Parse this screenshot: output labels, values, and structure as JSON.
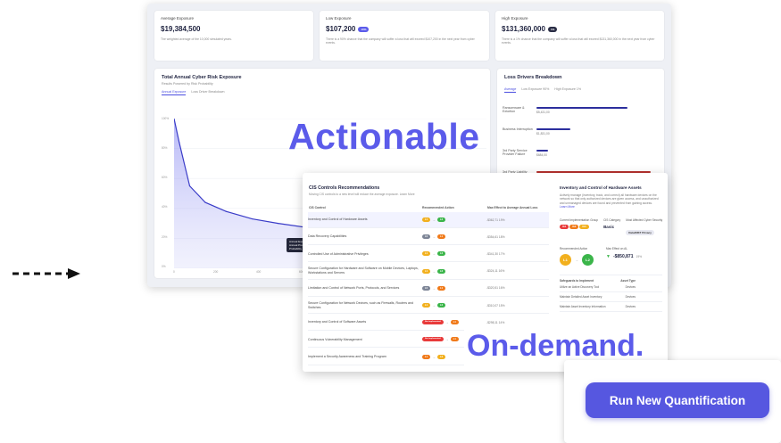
{
  "summary_cards": [
    {
      "title": "Average Exposure",
      "value": "$19,384,500",
      "tag": "",
      "desc": "The weighted average of the 10,000 simulated years."
    },
    {
      "title": "Low Exposure",
      "value": "$107,200",
      "tag": "10%",
      "desc": "There is a 90% chance that the company will suffer a loss that will exceed $107,200 in the next year from cyber events."
    },
    {
      "title": "High Exposure",
      "value": "$131,360,000",
      "tag": "1%",
      "desc": "There is a 1% chance that the company will suffer a loss that will exceed $131,360,000 in the next year from cyber events."
    }
  ],
  "exposure_chart": {
    "title": "Total Annual Cyber Risk Exposure",
    "subtitle": "Results Powered by Risk Probability",
    "tabs": [
      "Annual Exposure",
      "Loss Driver Breakdown"
    ],
    "y_ticks": [
      "100%",
      "80%",
      "60%",
      "40%",
      "20%",
      "0%"
    ],
    "x_ticks": [
      "0",
      "200",
      "400",
      "600"
    ],
    "tooltip": [
      "Annual Expo",
      "Annual Prob",
      "Probability"
    ]
  },
  "chart_data": {
    "type": "area",
    "title": "Total Annual Cyber Risk Exposure",
    "ylabel": "",
    "xlabel": "",
    "x": [
      0,
      10,
      30,
      60,
      100,
      150,
      200,
      300,
      400,
      500,
      580
    ],
    "y": [
      100,
      84,
      55,
      44,
      38,
      33,
      30,
      25,
      21,
      18,
      16
    ],
    "ylim": [
      0,
      100
    ],
    "xlim": [
      0,
      600
    ],
    "grid": true
  },
  "loss_drivers": {
    "title": "Loss Drivers Breakdown",
    "tabs": [
      "Average",
      "Low Exposure 90%",
      "High Exposure 1%"
    ],
    "items": [
      {
        "label": "Ransomware & Extortion",
        "value": "$5,431,00",
        "color": "#2c2f9e",
        "frac": 0.8
      },
      {
        "label": "Business Interruption",
        "value": "$1,831,00",
        "color": "#2c2f9e",
        "frac": 0.3
      },
      {
        "label": "3rd Party Service Provider Failure",
        "value": "$684,00",
        "color": "#2c2f9e",
        "frac": 0.1
      },
      {
        "label": "3rd Party Liability",
        "value": "$6,743,00",
        "color": "#b8322f",
        "frac": 1.0
      }
    ]
  },
  "overlay": {
    "actionable": "Actionable",
    "on_demand": "On-demand.",
    "run_button": "Run New Quantification"
  },
  "recommendations": {
    "title": "CIS Controls Recommendations",
    "subtitle": "Moving CIS controls to a new level will reduce the average exposure. Learn More",
    "columns": [
      "CIS Control",
      "Recommended Action",
      "Max Effect to Average Annual Loss"
    ],
    "rows": [
      {
        "name": "Inventory and Control of Hardware Assets",
        "from": "L1",
        "to": "L2",
        "from_color": "#f2b01e",
        "to_color": "#3bb54a",
        "effect": "-$362,71 19%"
      },
      {
        "name": "Data Recovery Capabilities",
        "from": "L0",
        "to": "L1",
        "from_color": "#7d8596",
        "to_color": "#f07a1a",
        "effect": "-$354,61 18%"
      },
      {
        "name": "Controlled Use of Administrative Privileges",
        "from": "L1",
        "to": "L2",
        "from_color": "#f2b01e",
        "to_color": "#3bb54a",
        "effect": "-$341,30 17%"
      },
      {
        "name": "Secure Configuration for Hardware and Software on Mobile Devices, Laptops, Workstations and Servers",
        "from": "L1",
        "to": "L2",
        "from_color": "#f2b01e",
        "to_color": "#3bb54a",
        "effect": "-$324,11 16%"
      },
      {
        "name": "Limitation and Control of Network Ports, Protocols, and Services",
        "from": "L0",
        "to": "L1",
        "from_color": "#7d8596",
        "to_color": "#f07a1a",
        "effect": "-$320,51 16%"
      },
      {
        "name": "Secure Configuration for Network Devices, such as Firewalls, Routers and Switches",
        "from": "L1",
        "to": "L2",
        "from_color": "#f2b01e",
        "to_color": "#3bb54a",
        "effect": "-$310,07 15%"
      },
      {
        "name": "Inventory and Control of Software Assets",
        "from": "Not implemented",
        "to": "L1",
        "from_color": "#e83a3a",
        "to_color": "#f07a1a",
        "effect": "-$298,11 14%"
      },
      {
        "name": "Continuous Vulnerability Management",
        "from": "Not implemented",
        "to": "L1",
        "from_color": "#e83a3a",
        "to_color": "#f07a1a",
        "effect": "-$281,40 13%"
      },
      {
        "name": "Implement a Security Awareness and Training Program",
        "from": "L1",
        "to": "L2",
        "from_color": "#f07a1a",
        "to_color": "#f2b01e",
        "effect": "-$270,63 12%"
      }
    ]
  },
  "detail": {
    "title": "Inventory and Control of Hardware Assets",
    "desc": "Actively manage (inventory, track, and correct) all hardware devices on the network so that only authorized devices are given access, and unauthorized and unmanaged devices are found and prevented from gaining access.",
    "learn_more": "Learn More",
    "impl_label": "Current Implementation Group",
    "impl_groups": [
      "IG1",
      "IG2",
      "IG3"
    ],
    "cis_category_label": "CIS Category",
    "cis_category": "Basic",
    "nist_label": "Most Affected Cyber Security",
    "nist": "Data/NIST Privacy",
    "recommended_label": "Recommended Action",
    "rec_from": "L1",
    "rec_to": "L2",
    "max_effect_label": "Max Effect on AL",
    "max_effect": "-$850,871",
    "max_effect_pct": "19%",
    "table_headers": [
      "Safeguards to Implement",
      "Asset Type"
    ],
    "table_rows": [
      {
        "name": "Utilize an Active Discovery Tool",
        "type": "Devices"
      },
      {
        "name": "Maintain Detailed Asset Inventory",
        "type": "Devices"
      },
      {
        "name": "Maintain Asset Inventory Information",
        "type": "Devices"
      }
    ]
  }
}
